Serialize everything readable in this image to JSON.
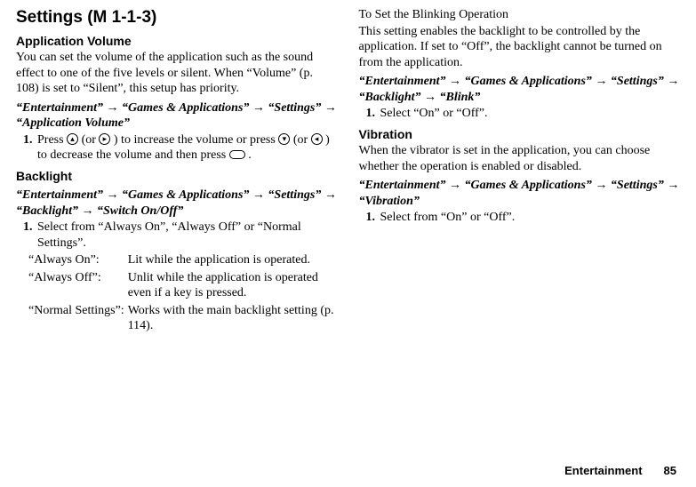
{
  "heading": "Settings (M 1-1-3)",
  "left": {
    "appvol": {
      "title": "Application Volume",
      "body": "You can set the volume of the application such as the sound effect to one of the five levels or silent. When “Volume” (p. 108) is set to “Silent”, this setup has priority.",
      "nav_a": "“Entertainment”",
      "nav_b": "“Games & Applications”",
      "nav_c": "“Settings”",
      "nav_d": "“Application Volume”",
      "step1_a": "Press ",
      "step1_b": " (or ",
      "step1_c": ") to increase the volume or press ",
      "step1_d": " (or ",
      "step1_e": ") to decrease the volume and then press ",
      "step1_f": "."
    },
    "backlight": {
      "title": "Backlight",
      "nav_a": "“Entertainment”",
      "nav_b": "“Games & Applications”",
      "nav_c": "“Settings”",
      "nav_d": "“Backlight”",
      "nav_e": "“Switch On/Off”",
      "step1": "Select from “Always On”, “Always Off” or “Normal Settings”.",
      "opts": {
        "k1": "“Always On”:",
        "v1": "Lit while the application is operated.",
        "k2": "“Always Off”:",
        "v2": "Unlit while the application is operated even if a key is pressed.",
        "k3": "“Normal Settings”:",
        "v3": "Works with the main backlight setting (p. 114)."
      }
    }
  },
  "right": {
    "blink": {
      "title": "To Set the Blinking Operation",
      "body": "This setting enables the backlight to be controlled by the application. If set to “Off”, the backlight cannot be turned on from the application.",
      "nav_a": "“Entertainment”",
      "nav_b": "“Games & Applications”",
      "nav_c": "“Settings”",
      "nav_d": "“Backlight”",
      "nav_e": "“Blink”",
      "step1": "Select “On” or “Off”."
    },
    "vibration": {
      "title": "Vibration",
      "body": "When the vibrator is set in the application, you can choose whether the operation is enabled or disabled.",
      "nav_a": "“Entertainment”",
      "nav_b": "“Games & Applications”",
      "nav_c": "“Settings”",
      "nav_d": "“Vibration”",
      "step1": "Select from “On” or “Off”."
    }
  },
  "arrow": "→",
  "icons": {
    "up": "▴",
    "right": "▸",
    "down": "▾",
    "left": "◂",
    "center": " "
  },
  "footer": {
    "section": "Entertainment",
    "page": "85"
  }
}
